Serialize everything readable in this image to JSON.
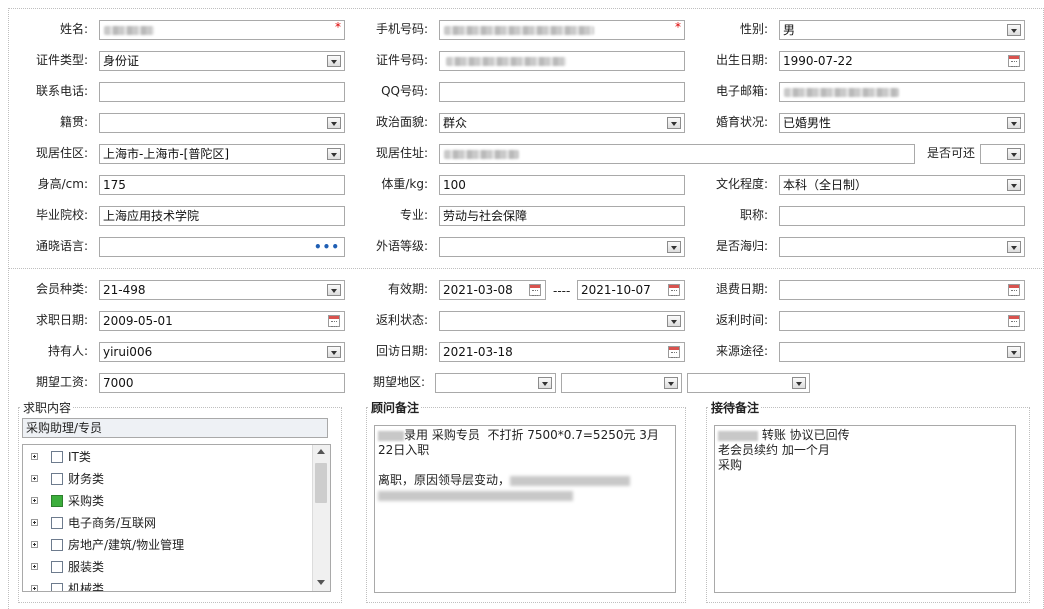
{
  "basic": {
    "name_label": "姓名:",
    "phone_label": "手机号码:",
    "gender_label": "性别:",
    "gender_value": "男",
    "id_type_label": "证件类型:",
    "id_type_value": "身份证",
    "id_no_label": "证件号码:",
    "birth_label": "出生日期:",
    "birth_value": "1990-07-22",
    "tel_label": "联系电话:",
    "qq_label": "QQ号码:",
    "email_label": "电子邮箱:",
    "origin_label": "籍贯:",
    "political_label": "政治面貌:",
    "political_value": "群众",
    "marital_label": "婚育状况:",
    "marital_value": "已婚男性",
    "residence_label": "现居住区:",
    "residence_value": "上海市-上海市-[普陀区]",
    "address_label": "现居住址:",
    "accessible_label": "是否可还",
    "height_label": "身高/cm:",
    "height_value": "175",
    "weight_label": "体重/kg:",
    "weight_value": "100",
    "education_label": "文化程度:",
    "education_value": "本科（全日制）",
    "school_label": "毕业院校:",
    "school_value": "上海应用技术学院",
    "major_label": "专业:",
    "major_value": "劳动与社会保障",
    "title_label": "职称:",
    "language_label": "通晓语言:",
    "language_more": "•••",
    "foreign_label": "外语等级:",
    "returnee_label": "是否海归:"
  },
  "member": {
    "type_label": "会员种类:",
    "type_value": "21-498",
    "valid_label": "有效期:",
    "valid_from": "2021-03-08",
    "valid_sep": "----",
    "valid_to": "2021-10-07",
    "refund_label": "退费日期:",
    "apply_label": "求职日期:",
    "apply_value": "2009-05-01",
    "rebate_status_label": "返利状态:",
    "rebate_time_label": "返利时间:",
    "holder_label": "持有人:",
    "holder_value": "yirui006",
    "visit_label": "回访日期:",
    "visit_value": "2021-03-18",
    "source_label": "来源途径:",
    "salary_label": "期望工资:",
    "salary_value": "7000",
    "region_label": "期望地区:"
  },
  "job": {
    "title": "求职内容",
    "selected": "采购助理/专员",
    "tree": [
      {
        "label": "IT类",
        "checked": false
      },
      {
        "label": "财务类",
        "checked": false
      },
      {
        "label": "采购类",
        "checked": true
      },
      {
        "label": "电子商务/互联网",
        "checked": false
      },
      {
        "label": "房地产/建筑/物业管理",
        "checked": false
      },
      {
        "label": "服装类",
        "checked": false
      },
      {
        "label": "机械类",
        "checked": false
      }
    ]
  },
  "advisor": {
    "title": "顾问备注",
    "line1": "录用 采购专员  不打折 7500*0.7=5250元 3月22日入职",
    "line2": "离职，原因领导层变动，"
  },
  "reception": {
    "title": "接待备注",
    "line1": " 转账 协议已回传",
    "line2": "老会员续约 加一个月",
    "line3": "采购"
  },
  "colors": {
    "required": "#dd0000",
    "checked": "#3cae3c",
    "more_dots": "#1f5fb4"
  }
}
